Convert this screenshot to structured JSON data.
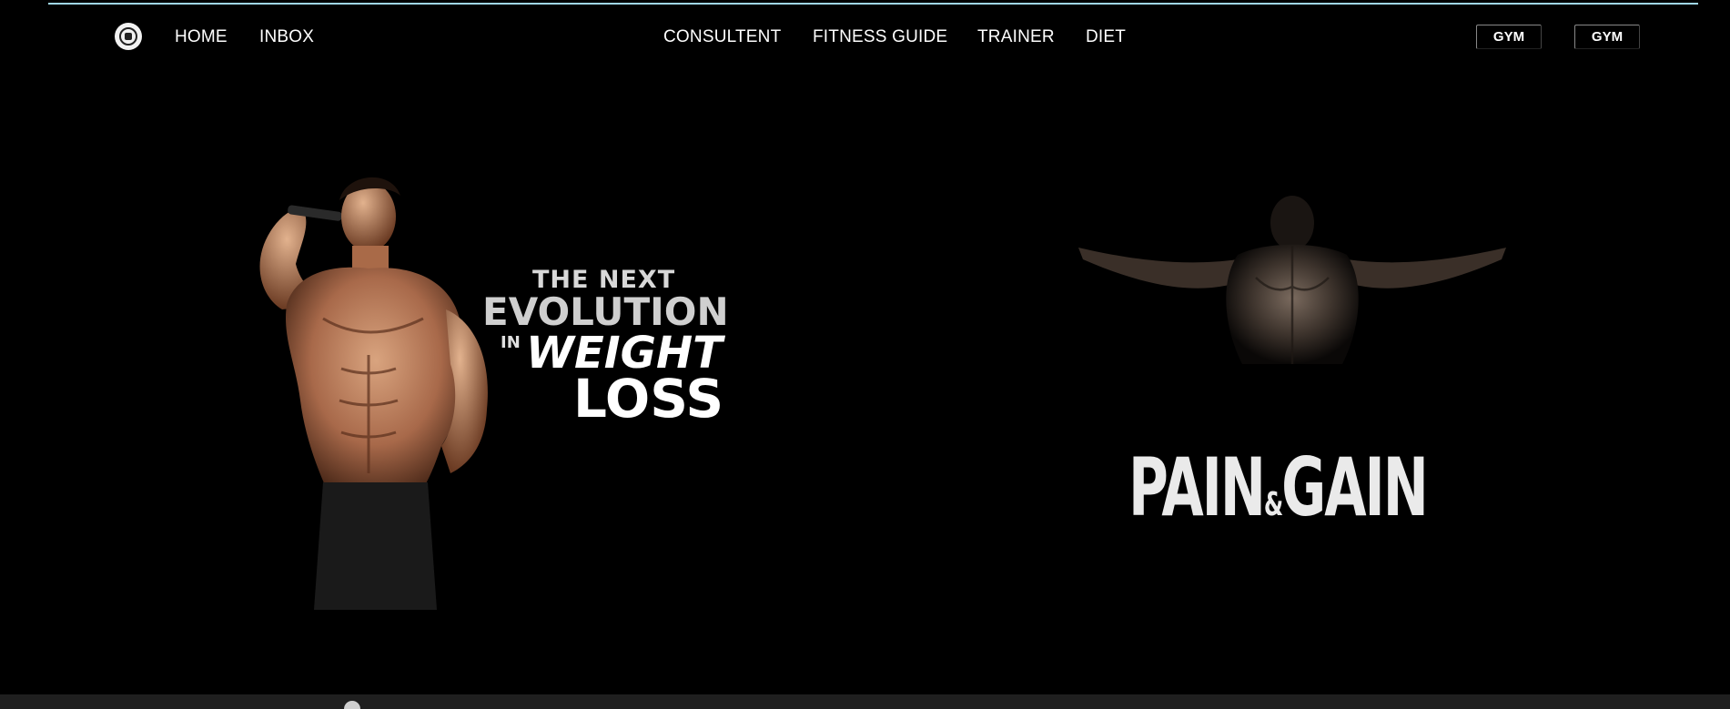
{
  "nav": {
    "logo_icon": "gym-logo-icon",
    "left_links": [
      "HOME",
      "INBOX"
    ],
    "center_links": [
      "CONSULTENT",
      "FITNESS GUIDE",
      "TRAINER",
      "DIET"
    ],
    "buttons": [
      "GYM",
      "GYM"
    ]
  },
  "hero_left": {
    "line1": "THE NEXT",
    "line2": "EVOLUTION",
    "line3_prefix": "IN",
    "line3": "WEIGHT",
    "line4": "LOSS"
  },
  "hero_right": {
    "title_part1": "PAIN",
    "title_amp": "&",
    "title_part2": "GAIN"
  },
  "colors": {
    "background": "#000000",
    "top_rule": "#9fd6e6",
    "text": "#ffffff"
  }
}
